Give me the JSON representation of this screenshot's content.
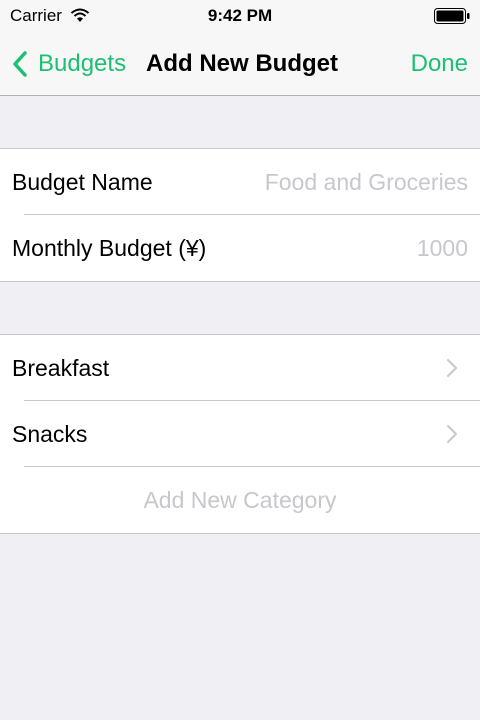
{
  "status_bar": {
    "carrier": "Carrier",
    "time": "9:42 PM"
  },
  "nav": {
    "back_label": "Budgets",
    "title": "Add New Budget",
    "done_label": "Done"
  },
  "budget_form": {
    "name_label": "Budget Name",
    "name_placeholder": "Food and Groceries",
    "monthly_label": "Monthly Budget (¥)",
    "monthly_placeholder": "1000"
  },
  "categories": {
    "items": [
      {
        "label": "Breakfast"
      },
      {
        "label": "Snacks"
      }
    ],
    "add_label": "Add New Category"
  },
  "colors": {
    "accent": "#1dbf73",
    "background": "#efeff4",
    "placeholder": "#c7c7cd"
  }
}
